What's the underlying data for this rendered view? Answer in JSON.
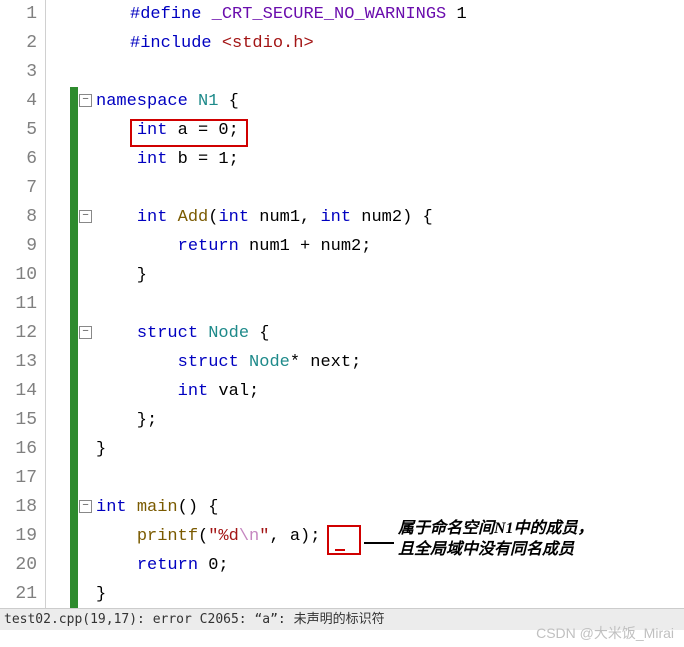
{
  "lines": {
    "l1a": "#define ",
    "l1b": "_CRT_SECURE_NO_WARNINGS",
    "l1c": " 1",
    "l2a": "#include ",
    "l2b": "<stdio.h>",
    "l4a": "namespace ",
    "l4b": "N1",
    "l4c": " {",
    "l5a": "    ",
    "l5b": "int",
    "l5c": " a = 0;",
    "l6a": "    ",
    "l6b": "int",
    "l6c": " b = 1;",
    "l8a": "    ",
    "l8b": "int",
    "l8c": " ",
    "l8d": "Add",
    "l8e": "(",
    "l8f": "int",
    "l8g": " num1, ",
    "l8h": "int",
    "l8i": " num2) {",
    "l9a": "        ",
    "l9b": "return",
    "l9c": " num1 + num2;",
    "l10": "    }",
    "l12a": "    ",
    "l12b": "struct",
    "l12c": " ",
    "l12d": "Node",
    "l12e": " {",
    "l13a": "        ",
    "l13b": "struct",
    "l13c": " ",
    "l13d": "Node",
    "l13e": "* next;",
    "l14a": "        ",
    "l14b": "int",
    "l14c": " val;",
    "l15": "    };",
    "l16": "}",
    "l18a": "int",
    "l18b": " ",
    "l18c": "main",
    "l18d": "() {",
    "l19a": "    ",
    "l19b": "printf",
    "l19c": "(",
    "l19d": "\"%d",
    "l19e": "\\n",
    "l19f": "\"",
    "l19g": ", a);",
    "l20a": "    ",
    "l20b": "return",
    "l20c": " 0;",
    "l21": "}"
  },
  "gutter": [
    "1",
    "2",
    "3",
    "4",
    "5",
    "6",
    "7",
    "8",
    "9",
    "10",
    "11",
    "12",
    "13",
    "14",
    "15",
    "16",
    "17",
    "18",
    "19",
    "20",
    "21"
  ],
  "annotation": {
    "line1": "属于命名空间N1中的成员，",
    "line2": "且全局域中没有同名成员"
  },
  "error": "test02.cpp(19,17): error C2065: “a”: 未声明的标识符",
  "watermark": "CSDN @大米饭_Mirai",
  "fold": "−"
}
